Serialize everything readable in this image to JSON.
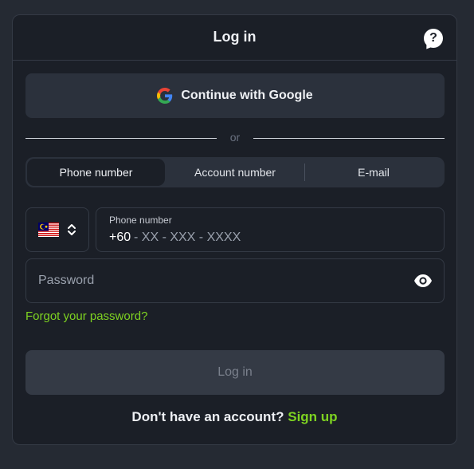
{
  "header": {
    "title": "Log in",
    "help_icon": "question-bubble-icon",
    "help_glyph": "?"
  },
  "google": {
    "label": "Continue with Google",
    "icon": "google-logo-icon"
  },
  "divider": {
    "text": "or"
  },
  "tabs": [
    {
      "label": "Phone number",
      "active": true
    },
    {
      "label": "Account number",
      "active": false
    },
    {
      "label": "E-mail",
      "active": false
    }
  ],
  "phone": {
    "country_flag": "malaysia-flag-icon",
    "country_chevron": "chevron-up-down-icon",
    "label": "Phone number",
    "prefix": "+60",
    "mask": " - XX - XXX - XXXX"
  },
  "password": {
    "placeholder": "Password",
    "icon": "eye-icon"
  },
  "forgot_label": "Forgot your password?",
  "login_label": "Log in",
  "signup": {
    "prompt": "Don't have an account?",
    "link": "Sign up"
  },
  "colors": {
    "accent": "#7ed321",
    "background": "#252a33",
    "panel": "#1b1f27",
    "button": "#2b313c"
  }
}
